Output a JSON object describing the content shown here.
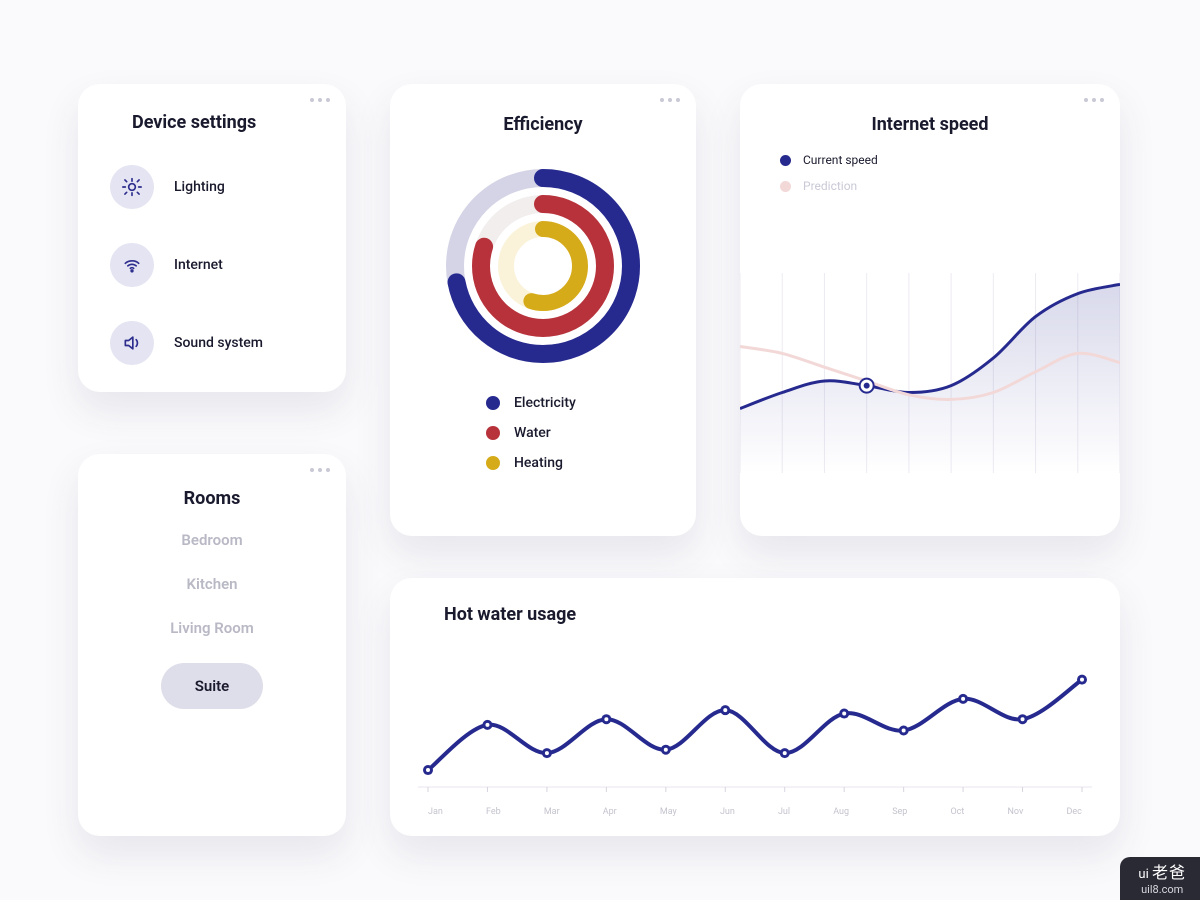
{
  "colors": {
    "primary": "#262a8f",
    "red": "#b7323b",
    "yellow": "#d6ab1a",
    "lavender": "#d4d4e6",
    "pink": "#f3d8d8",
    "track_light": "#f2eeee",
    "track_yellow": "#faf3da"
  },
  "device_settings": {
    "title": "Device settings",
    "items": [
      {
        "icon": "lightbulb-icon",
        "label": "Lighting"
      },
      {
        "icon": "wifi-icon",
        "label": "Internet"
      },
      {
        "icon": "speaker-icon",
        "label": "Sound system"
      }
    ]
  },
  "rooms": {
    "title": "Rooms",
    "items": [
      "Bedroom",
      "Kitchen",
      "Living Room",
      "Suite"
    ],
    "active": "Suite"
  },
  "efficiency": {
    "title": "Efficiency",
    "legend": [
      {
        "label": "Electricity",
        "color": "#262a8f"
      },
      {
        "label": "Water",
        "color": "#b7323b"
      },
      {
        "label": "Heating",
        "color": "#d6ab1a"
      }
    ]
  },
  "internet_speed": {
    "title": "Internet speed",
    "legend": [
      {
        "label": "Current speed",
        "color": "#262a8f",
        "muted": false
      },
      {
        "label": "Prediction",
        "color": "#f3d8d8",
        "muted": true
      }
    ]
  },
  "hot_water": {
    "title": "Hot water usage",
    "months": [
      "Jan",
      "Feb",
      "Mar",
      "Apr",
      "May",
      "Jun",
      "Jul",
      "Aug",
      "Sep",
      "Oct",
      "Nov",
      "Dec"
    ]
  },
  "watermark": {
    "brand_prefix": "ui",
    "brand_cn": "老爸",
    "url": "uil8.com"
  },
  "chart_data": [
    {
      "type": "pie",
      "title": "Efficiency",
      "series": [
        {
          "name": "Electricity",
          "value": 72,
          "color": "#262a8f"
        },
        {
          "name": "Water",
          "value": 80,
          "color": "#b7323b"
        },
        {
          "name": "Heating",
          "value": 55,
          "color": "#d6ab1a"
        }
      ],
      "note": "concentric radial gauges; value = percent of full circle"
    },
    {
      "type": "line",
      "title": "Internet speed",
      "xlabel": "",
      "ylabel": "",
      "ylim": [
        0,
        100
      ],
      "x": [
        0,
        1,
        2,
        3,
        4,
        5,
        6,
        7,
        8,
        9
      ],
      "series": [
        {
          "name": "Current speed",
          "color": "#262a8f",
          "values": [
            28,
            35,
            40,
            38,
            35,
            38,
            50,
            68,
            78,
            82
          ]
        },
        {
          "name": "Prediction",
          "color": "#f3d8d8",
          "values": [
            55,
            52,
            46,
            40,
            34,
            32,
            35,
            44,
            52,
            48
          ]
        }
      ]
    },
    {
      "type": "line",
      "title": "Hot water usage",
      "xlabel": "",
      "ylabel": "",
      "ylim": [
        0,
        100
      ],
      "categories": [
        "Jan",
        "Feb",
        "Mar",
        "Apr",
        "May",
        "Jun",
        "Jul",
        "Aug",
        "Sep",
        "Oct",
        "Nov",
        "Dec"
      ],
      "series": [
        {
          "name": "Usage",
          "color": "#262a8f",
          "values": [
            15,
            55,
            30,
            60,
            33,
            68,
            30,
            65,
            50,
            78,
            60,
            95
          ]
        }
      ]
    }
  ]
}
